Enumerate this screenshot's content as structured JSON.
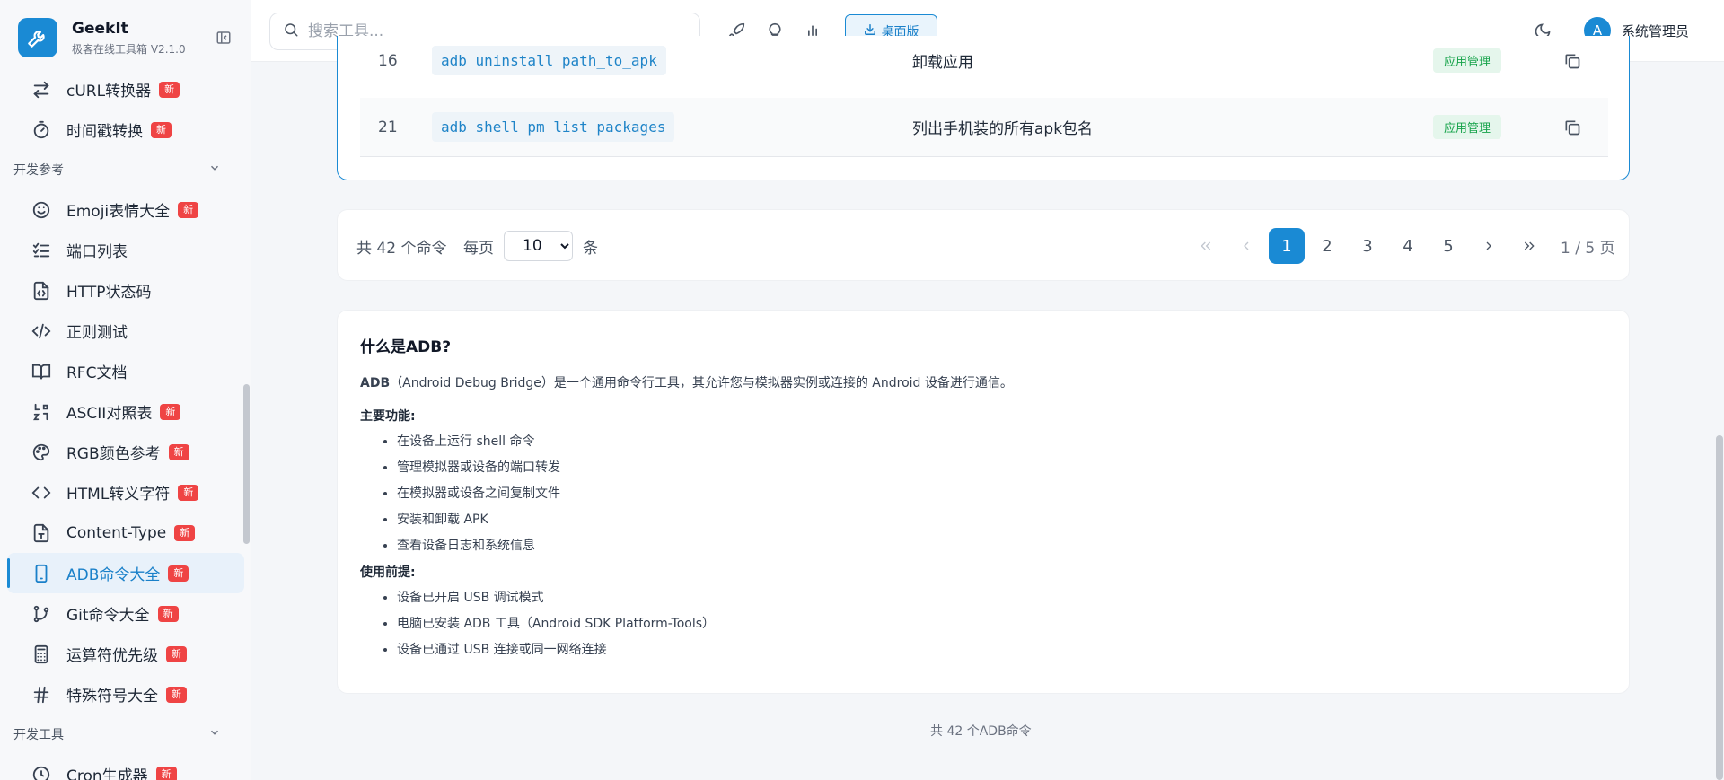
{
  "brand": {
    "name": "GeekIt",
    "subtitle": "极客在线工具箱",
    "version": "V2.1.0"
  },
  "sidebar": {
    "items_top": [
      {
        "label": "cURL转换器",
        "badge": "新",
        "icon": "arrows-swap-icon"
      },
      {
        "label": "时间戳转换",
        "badge": "新",
        "icon": "timer-icon"
      }
    ],
    "group_dev_ref": "开发参考",
    "items": [
      {
        "label": "Emoji表情大全",
        "badge": "新",
        "icon": "smiley-icon"
      },
      {
        "label": "端口列表",
        "badge": "",
        "icon": "list-check-icon"
      },
      {
        "label": "HTTP状态码",
        "badge": "",
        "icon": "file-code-icon"
      },
      {
        "label": "正则测试",
        "badge": "",
        "icon": "code-icon"
      },
      {
        "label": "RFC文档",
        "badge": "",
        "icon": "book-icon"
      },
      {
        "label": "ASCII对照表",
        "badge": "新",
        "icon": "ascii-icon"
      },
      {
        "label": "RGB颜色参考",
        "badge": "新",
        "icon": "palette-icon"
      },
      {
        "label": "HTML转义字符",
        "badge": "新",
        "icon": "angle-brackets-icon"
      },
      {
        "label": "Content-Type",
        "badge": "新",
        "icon": "file-type-icon"
      },
      {
        "label": "ADB命令大全",
        "badge": "新",
        "icon": "phone-icon"
      },
      {
        "label": "Git命令大全",
        "badge": "新",
        "icon": "git-branch-icon"
      },
      {
        "label": "运算符优先级",
        "badge": "新",
        "icon": "calculator-icon"
      },
      {
        "label": "特殊符号大全",
        "badge": "新",
        "icon": "hash-icon"
      }
    ],
    "group_dev_tools": "开发工具",
    "item_partial": {
      "label": "Cron生成器",
      "badge": "新"
    }
  },
  "header": {
    "search_placeholder": "搜索工具...",
    "desktop_label": "桌面版",
    "user_initial": "A",
    "user_name": "系统管理员"
  },
  "table": {
    "rows": [
      {
        "num": "16",
        "cmd": "adb uninstall path_to_apk",
        "desc": "卸载应用",
        "category": "应用管理"
      },
      {
        "num": "21",
        "cmd": "adb shell pm list packages",
        "desc": "列出手机装的所有apk包名",
        "category": "应用管理"
      }
    ]
  },
  "pager": {
    "total": "共 42 个命令",
    "perpage_label": "每页",
    "perpage_value": "10",
    "perpage_options": [
      "10"
    ],
    "unit": "条",
    "pages": [
      "1",
      "2",
      "3",
      "4",
      "5"
    ],
    "current": "1",
    "page_info": "1 / 5 页"
  },
  "info": {
    "title": "什么是ADB?",
    "intro_strong": "ADB",
    "intro": "（Android Debug Bridge）是一个通用命令行工具，其允许您与模拟器实例或连接的 Android 设备进行通信。",
    "features_title": "主要功能:",
    "features": [
      "在设备上运行 shell 命令",
      "管理模拟器或设备的端口转发",
      "在模拟器或设备之间复制文件",
      "安装和卸载 APK",
      "查看设备日志和系统信息"
    ],
    "prereq_title": "使用前提:",
    "prereqs": [
      "设备已开启 USB 调试模式",
      "电脑已安装 ADB 工具（Android SDK Platform-Tools）",
      "设备已通过 USB 连接或同一网络连接"
    ]
  },
  "footer_note": "共 42 个ADB命令",
  "colors": {
    "accent": "#1a8ad4",
    "badge": "#ef4444",
    "category_bg": "#e5f6ec",
    "category_fg": "#16a34a"
  }
}
